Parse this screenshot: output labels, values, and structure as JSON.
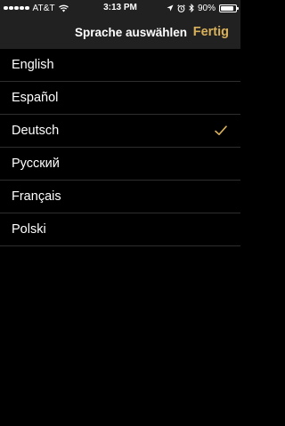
{
  "status_bar": {
    "carrier": "AT&T",
    "time": "3:13 PM",
    "battery_percent": "90%",
    "battery_level": 0.9,
    "icons": [
      "signal-dots-icon",
      "wifi-icon",
      "location-arrow-icon",
      "alarm-clock-icon",
      "bluetooth-icon",
      "battery-icon"
    ]
  },
  "nav_bar": {
    "title": "Sprache auswählen",
    "done_label": "Fertig"
  },
  "colors": {
    "background": "#000000",
    "bar_background": "#212121",
    "accent": "#d8b15a",
    "separator": "#2e2e2e",
    "text": "#ffffff"
  },
  "languages": [
    {
      "label": "English",
      "selected": false
    },
    {
      "label": "Español",
      "selected": false
    },
    {
      "label": "Deutsch",
      "selected": true
    },
    {
      "label": "Русский",
      "selected": false
    },
    {
      "label": "Français",
      "selected": false
    },
    {
      "label": "Polski",
      "selected": false
    }
  ]
}
